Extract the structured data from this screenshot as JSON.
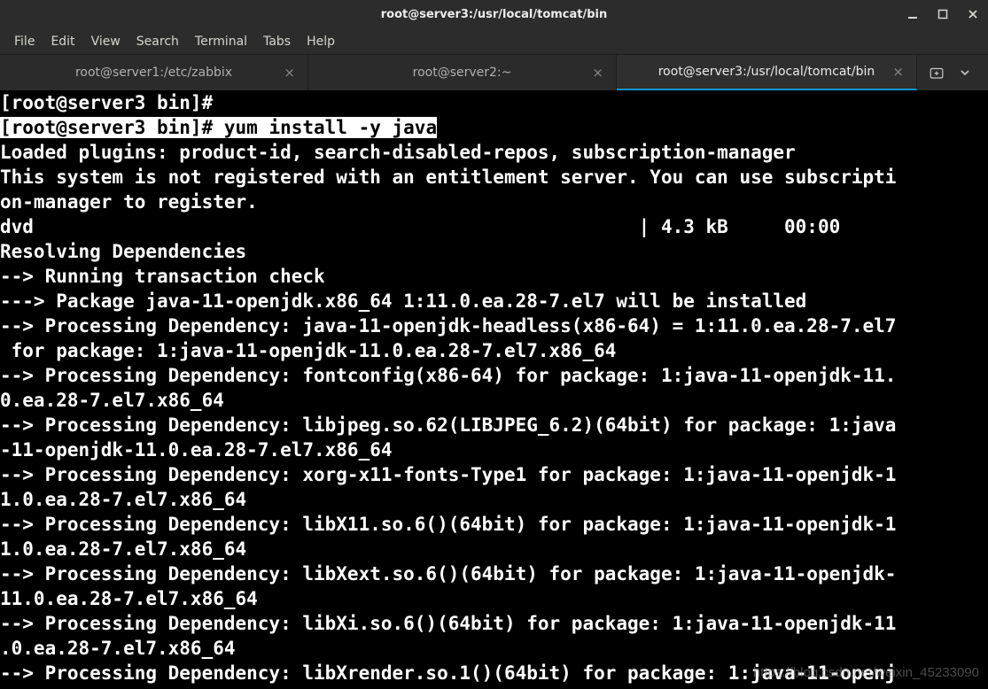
{
  "window": {
    "title": "root@server3:/usr/local/tomcat/bin"
  },
  "menu": {
    "items": [
      "File",
      "Edit",
      "View",
      "Search",
      "Terminal",
      "Tabs",
      "Help"
    ]
  },
  "tabs": {
    "items": [
      {
        "label": "root@server1:/etc/zabbix",
        "active": false
      },
      {
        "label": "root@server2:~",
        "active": false
      },
      {
        "label": "root@server3:/usr/local/tomcat/bin",
        "active": true
      }
    ]
  },
  "terminal": {
    "prompt1": "[root@server3 bin]# ",
    "prompt2": "[root@server3 bin]# ",
    "command": "yum install -y java",
    "lines": {
      "l1": "Loaded plugins: product-id, search-disabled-repos, subscription-manager",
      "l2": "This system is not registered with an entitlement server. You can use subscripti",
      "l3": "on-manager to register.",
      "l4": "dvd                                                      | 4.3 kB     00:00",
      "l5": "Resolving Dependencies",
      "l6": "--> Running transaction check",
      "l7": "---> Package java-11-openjdk.x86_64 1:11.0.ea.28-7.el7 will be installed",
      "l8": "--> Processing Dependency: java-11-openjdk-headless(x86-64) = 1:11.0.ea.28-7.el7",
      "l9": " for package: 1:java-11-openjdk-11.0.ea.28-7.el7.x86_64",
      "l10": "--> Processing Dependency: fontconfig(x86-64) for package: 1:java-11-openjdk-11.",
      "l11": "0.ea.28-7.el7.x86_64",
      "l12": "--> Processing Dependency: libjpeg.so.62(LIBJPEG_6.2)(64bit) for package: 1:java",
      "l13": "-11-openjdk-11.0.ea.28-7.el7.x86_64",
      "l14": "--> Processing Dependency: xorg-x11-fonts-Type1 for package: 1:java-11-openjdk-1",
      "l15": "1.0.ea.28-7.el7.x86_64",
      "l16": "--> Processing Dependency: libX11.so.6()(64bit) for package: 1:java-11-openjdk-1",
      "l17": "1.0.ea.28-7.el7.x86_64",
      "l18": "--> Processing Dependency: libXext.so.6()(64bit) for package: 1:java-11-openjdk-",
      "l19": "11.0.ea.28-7.el7.x86_64",
      "l20": "--> Processing Dependency: libXi.so.6()(64bit) for package: 1:java-11-openjdk-11",
      "l21": ".0.ea.28-7.el7.x86_64",
      "l22": "--> Processing Dependency: libXrender.so.1()(64bit) for package: 1:java-11-openj"
    }
  },
  "watermark": "https://blog.csdn.net/weixin_45233090"
}
